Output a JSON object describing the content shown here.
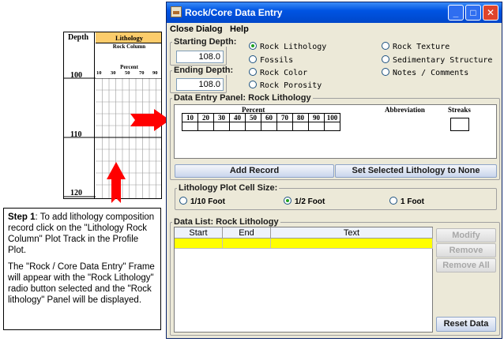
{
  "profile_plot": {
    "depth_header": "Depth",
    "track_title": "Lithology",
    "track_subtitle": "Rock Column",
    "percent_label": "Percent",
    "tick_labels": [
      "10",
      "30",
      "50",
      "70",
      "90"
    ],
    "depth_labels": [
      "100",
      "110",
      "120"
    ],
    "track_color": "#fccc6b"
  },
  "step_box": {
    "heading": "Step 1",
    "paragraph1": ": To add lithology composition record click on the \"Lithology Rock Column\" Plot Track in the Profile Plot.",
    "paragraph2": "The \"Rock / Core Data Entry\" Frame will appear with the \"Rock Lithology\" radio button selected and the \"Rock lithology\" Panel will  be displayed."
  },
  "window": {
    "title": "Rock/Core Data Entry",
    "controls": {
      "minimize": "_",
      "maximize": "□",
      "close": "✕"
    },
    "menu": [
      "Close Dialog",
      "Help"
    ],
    "starting_depth": {
      "label": "Starting Depth:",
      "value": "108.0"
    },
    "ending_depth": {
      "label": "Ending Depth:",
      "value": "108.0"
    },
    "radios": [
      {
        "label": "Rock Lithology",
        "checked": true
      },
      {
        "label": "Rock Texture",
        "checked": false
      },
      {
        "label": "Fossils",
        "checked": false
      },
      {
        "label": "Sedimentary Structure",
        "checked": false
      },
      {
        "label": "Rock Color",
        "checked": false
      },
      {
        "label": "Notes / Comments",
        "checked": false
      },
      {
        "label": "Rock Porosity",
        "checked": false
      }
    ],
    "data_entry_panel": {
      "title": "Data Entry Panel: Rock Lithology",
      "percent_label": "Percent",
      "percent_columns": [
        "10",
        "20",
        "30",
        "40",
        "50",
        "60",
        "70",
        "80",
        "90",
        "100"
      ],
      "abbreviation_label": "Abbreviation",
      "streaks_label": "Streaks",
      "add_record_button": "Add Record",
      "set_none_button": "Set Selected Lithology to None"
    },
    "cell_size": {
      "title": "Lithology Plot Cell Size:",
      "options": [
        {
          "label": "1/10 Foot",
          "checked": false
        },
        {
          "label": "1/2 Foot",
          "checked": true
        },
        {
          "label": "1 Foot",
          "checked": false
        }
      ]
    },
    "data_list": {
      "title": "Data List: Rock Lithology",
      "columns": [
        "Start",
        "End",
        "Text"
      ],
      "modify_button": "Modify",
      "remove_button": "Remove",
      "remove_all_button": "Remove All",
      "reset_button": "Reset Data"
    }
  },
  "colors": {
    "arrow": "#ff0000",
    "selected_row": "#ffff00",
    "title_bar": "#0054e3"
  }
}
